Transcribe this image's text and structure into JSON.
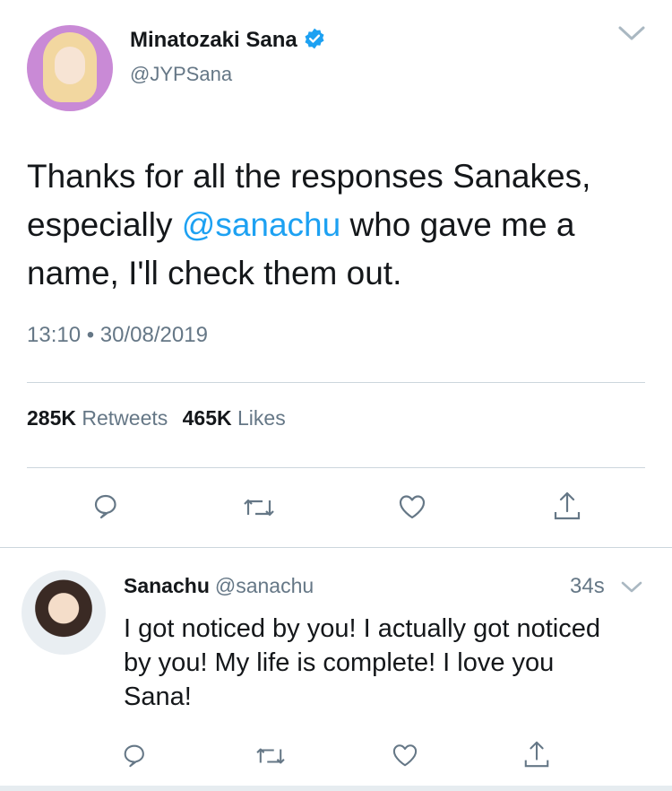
{
  "tweet": {
    "author_name": "Minatozaki Sana",
    "author_handle": "@JYPSana",
    "text_parts": {
      "before": "Thanks for all the responses Sanakes, especially ",
      "mention": "@sanachu",
      "after": " who gave me a name, I'll check them out."
    },
    "timestamp": "13:10 • 30/08/2019",
    "stats": {
      "retweets_count": "285K",
      "retweets_label": "Retweets",
      "likes_count": "465K",
      "likes_label": "Likes"
    },
    "actions": [
      "reply-icon",
      "retweet-icon",
      "like-icon",
      "share-icon"
    ]
  },
  "reply": {
    "author_name": "Sanachu",
    "author_handle": "@sanachu",
    "time": "34s",
    "text": "I got noticed by you! I actually got noticed by you! My life is complete! I love you Sana!",
    "actions": [
      "reply-icon",
      "retweet-icon",
      "like-icon",
      "share-icon"
    ]
  },
  "colors": {
    "text": "#14171a",
    "secondary": "#657786",
    "link": "#1da1f2",
    "divider": "#ccd6dd"
  }
}
